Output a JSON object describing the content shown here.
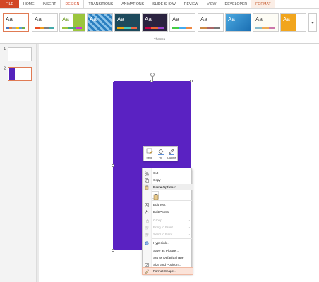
{
  "tabs": [
    "FILE",
    "HOME",
    "INSERT",
    "DESIGN",
    "TRANSITIONS",
    "ANIMATIONS",
    "SLIDE SHOW",
    "REVIEW",
    "VIEW",
    "DEVELOPER",
    "FORMAT"
  ],
  "ribbon": {
    "group_label": "Themes",
    "theme_tile_text": "Aa"
  },
  "slides": [
    {
      "number": "1"
    },
    {
      "number": "2"
    }
  ],
  "mini_toolbar": {
    "style": "Style",
    "fill": "Fill",
    "outline": "Outline"
  },
  "context_menu": {
    "cut": "Cut",
    "copy": "Copy",
    "paste_options": "Paste Options:",
    "edit_text": "Edit Text",
    "edit_points": "Edit Points",
    "group": "Group",
    "bring_to_front": "Bring to Front",
    "send_to_back": "Send to Back",
    "hyperlink": "Hyperlink...",
    "save_as_picture": "Save as Picture...",
    "set_default_shape": "Set as Default Shape",
    "size_position": "Size and Position...",
    "format_shape": "Format Shape..."
  },
  "colors": {
    "accent": "#d24726",
    "shape_fill": "#5a22c2"
  }
}
